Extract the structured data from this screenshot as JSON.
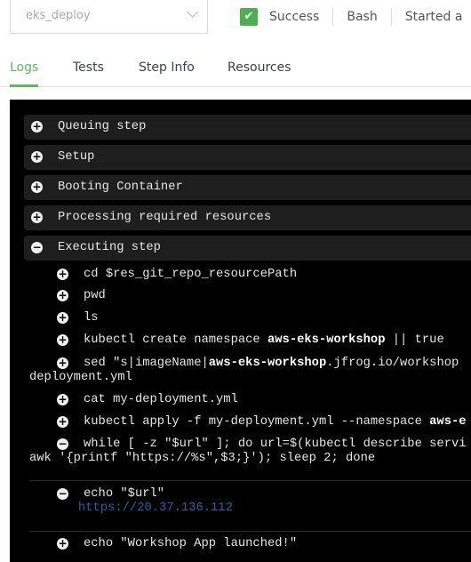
{
  "step_select": {
    "value": "eks_deploy"
  },
  "status": {
    "state": "Success",
    "type": "Bash",
    "started": "Started a"
  },
  "tabs": [
    {
      "label": "Logs",
      "active": true
    },
    {
      "label": "Tests"
    },
    {
      "label": "Step Info"
    },
    {
      "label": "Resources"
    }
  ],
  "sections": [
    {
      "label": "Queuing step",
      "expanded": false
    },
    {
      "label": "Setup",
      "expanded": false
    },
    {
      "label": "Booting Container",
      "expanded": false
    },
    {
      "label": "Processing required resources",
      "expanded": false
    },
    {
      "label": "Executing step",
      "expanded": true
    }
  ],
  "commands": {
    "c0": "cd $res_git_repo_resourcePath",
    "c1": "pwd",
    "c2": "ls",
    "c3a": "kubectl create namespace ",
    "c3b": "aws-eks-workshop",
    "c3c": " || true",
    "c4a": "sed \"s|imageName|",
    "c4b": "aws-eks-workshop",
    ".c4c": "",
    "c4c": ".jfrog.io/workshop",
    "c4d": "deployment.yml",
    "c5": "cat my-deployment.yml",
    "c6a": "kubectl apply -f my-deployment.yml --namespace ",
    "c6b": "aws-e",
    "c7a": "while [ -z \"$url\" ]; do url=$(kubectl describe servi",
    "c7b": "awk '{printf \"https://%s\",$3;}'); sleep 2; done",
    "c8": "echo \"$url\"",
    "c8_out": "https://20.37.136.112",
    "c9": "echo \"Workshop App launched!\""
  },
  "colors": {
    "success": "#4caf50",
    "accent": "#5cb85c",
    "link": "#2c5fa8",
    "console_bg": "#000000"
  }
}
